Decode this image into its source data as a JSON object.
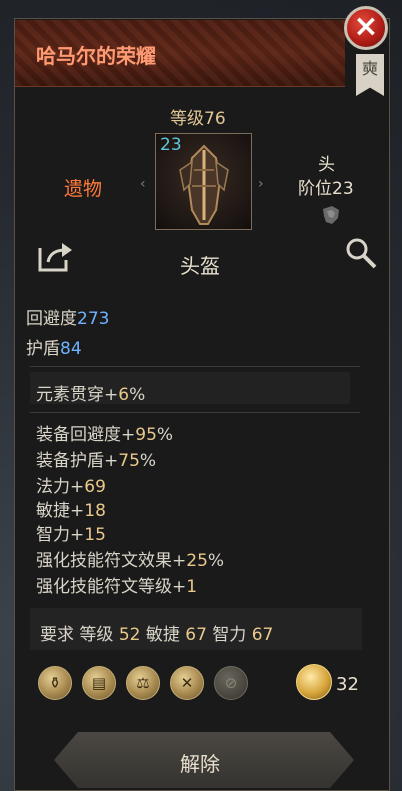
{
  "header": {
    "title": "哈马尔的荣耀",
    "close_icon": "close-icon",
    "banner_glyph": "奭"
  },
  "item": {
    "level_label": "等级76",
    "rarity": "遗物",
    "item_level": "23",
    "slot_name": "头",
    "slot_tier": "阶位23",
    "name": "头盔"
  },
  "base_stats": [
    {
      "label": "回避度",
      "value": "273"
    },
    {
      "label": "护盾",
      "value": "84"
    }
  ],
  "affixes": {
    "implicit": {
      "label": "元素贯穿+",
      "value": "6",
      "suffix": "%"
    },
    "explicit": [
      {
        "label": "装备回避度+",
        "value": "95",
        "suffix": "%"
      },
      {
        "label": "装备护盾+",
        "value": "75",
        "suffix": "%"
      },
      {
        "label": "法力+",
        "value": "69",
        "suffix": ""
      },
      {
        "label": "敏捷+",
        "value": "18",
        "suffix": ""
      },
      {
        "label": "智力+",
        "value": "15",
        "suffix": ""
      },
      {
        "label": "强化技能符文效果+",
        "value": "25",
        "suffix": "%"
      },
      {
        "label": "强化技能符文等级+",
        "value": "1",
        "suffix": ""
      }
    ]
  },
  "requirements": {
    "prefix": "要求",
    "level_label": "等级",
    "level_value": "52",
    "dex_label": "敏捷",
    "dex_value": "67",
    "int_label": "智力",
    "int_value": "67"
  },
  "crafting": {
    "icons": [
      "pouch-icon",
      "chest-icon",
      "scales-icon",
      "tools-icon",
      "disabled-tool-icon"
    ],
    "currency_count": "32"
  },
  "actions": {
    "dismantle_label": "解除"
  },
  "colors": {
    "title": "#ff9a73",
    "rarity": "#ff7a3b",
    "blue_value": "#6fb3ff",
    "gold_value": "#e9c98c"
  }
}
